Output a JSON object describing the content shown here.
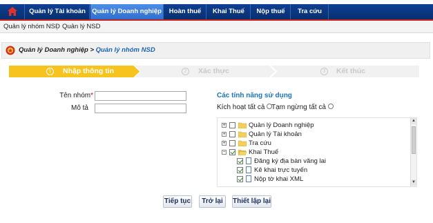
{
  "topnav": {
    "home_icon": "home-icon",
    "items": [
      {
        "label": "Quản lý Tài khoản"
      },
      {
        "label": "Quản lý Doanh nghiệp"
      },
      {
        "label": "Hoàn thuế"
      },
      {
        "label": "Khai Thuế"
      },
      {
        "label": "Nộp thuế"
      },
      {
        "label": "Tra cứu"
      }
    ],
    "active_index": 1,
    "colors": {
      "bar": "#0f3f93",
      "active": "#3f80dc",
      "underline": "#c81f1f"
    }
  },
  "subnav": {
    "items": [
      {
        "label": "Quản lý nhóm NSD"
      },
      {
        "label": "Quản lý NSD"
      }
    ]
  },
  "breadcrumb": {
    "icon": "emblem-icon",
    "root": "Quản lý Doanh nghiệp",
    "separator": " > ",
    "current": "Quản lý nhóm NSD"
  },
  "steps": [
    {
      "num": "1",
      "label": "Nhập thông tin",
      "active": true
    },
    {
      "num": "2",
      "label": "Xác thực",
      "active": false
    },
    {
      "num": "3",
      "label": "Kết thúc",
      "active": false
    }
  ],
  "form": {
    "group_name_label": "Tên nhóm",
    "required_mark": "*",
    "group_name_value": "",
    "description_label": "Mô tả",
    "description_value": ""
  },
  "features": {
    "title": "Các tính năng sử dụng",
    "activate_all": "Kích hoạt tất cả",
    "suspend_all": "Tạm ngừng tất cả",
    "tree": [
      {
        "label": "Quản lý Doanh nghiệp",
        "type": "folder",
        "expander": "+",
        "checked": false
      },
      {
        "label": "Quản lý Tài khoản",
        "type": "folder",
        "expander": "+",
        "checked": false
      },
      {
        "label": "Tra cứu",
        "type": "folder",
        "expander": "+",
        "checked": false
      },
      {
        "label": "Khai Thuế",
        "type": "folder",
        "expander": "−",
        "checked": true
      },
      {
        "label": "Đăng ký địa bàn vãng lai",
        "type": "doc",
        "checked": true
      },
      {
        "label": "Kê khai trực tuyến",
        "type": "doc",
        "checked": true
      },
      {
        "label": "Nộp tờ khai XML",
        "type": "doc",
        "checked": true
      }
    ]
  },
  "buttons": {
    "continue": "Tiếp tục",
    "back": "Trở lại",
    "reset": "Thiết lập lại"
  }
}
